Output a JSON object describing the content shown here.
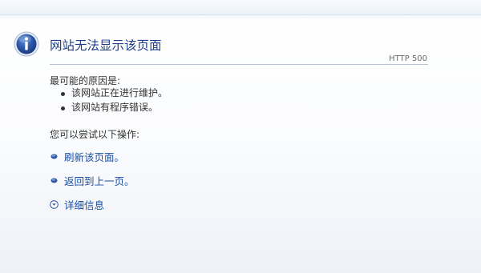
{
  "page": {
    "title": "网站无法显示该页面",
    "http_code": "HTTP 500"
  },
  "causes": {
    "heading": "最可能的原因是:",
    "items": [
      {
        "text": "该网站正在进行维护。"
      },
      {
        "text": "该网站有程序错误。"
      }
    ]
  },
  "actions": {
    "heading": "您可以尝试以下操作:",
    "refresh_label": "刷新该页面。",
    "back_label": "返回到上一页。",
    "details_label": "详细信息"
  },
  "icons": {
    "info": "info-icon",
    "refresh_bullet": "link-bullet-icon",
    "back_bullet": "link-bullet-icon",
    "details_toggle": "chevron-down-circle-icon"
  },
  "colors": {
    "title": "#1f3f86",
    "link": "#1a4ea3",
    "text": "#333333",
    "icon_fill": "#2c55a7",
    "rule": "#b7c3d1"
  }
}
